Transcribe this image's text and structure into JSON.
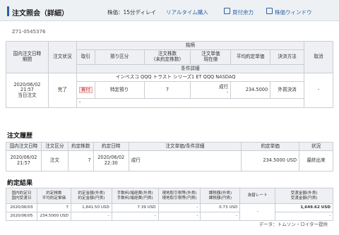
{
  "header": {
    "title": "注文照会（詳細）",
    "delay": "株価：15分ディレイ",
    "realtime_link": "リアルタイム購入",
    "buying_power_link": "買付余力",
    "window_link": "株価ウィンドウ"
  },
  "order_id": "Z71-0545376",
  "main_table": {
    "headers": {
      "order_datetime": "国内注文日時\n期間",
      "status": "注文状況",
      "brand": "銘柄",
      "side": "取引",
      "custody": "預り区分",
      "qty": "注文株数\n(未約定株数)",
      "price": "注文単価\n現在値",
      "avg_price": "平均約定単価",
      "settlement": "決済方法",
      "cancel": "取消",
      "conditions": "条件詳細"
    },
    "row": {
      "datetime": "2020/06/02\n21:57\n当日注文",
      "status": "完了",
      "brand": "インベスコ QQQ トラスト シリーズ1 ET QQQ NASDAQ",
      "side": "買付",
      "custody": "特定預り",
      "qty": "7",
      "order_price": "成行",
      "current_price": "-",
      "avg_price": "234.5000",
      "settlement": "外貨決済",
      "cancel": "-",
      "conditions": "-"
    }
  },
  "history": {
    "title": "注文履歴",
    "headers": [
      "国内注文日時",
      "注文区分",
      "約定株数",
      "約定日時",
      "注文単価/条件詳細",
      "約定単価",
      "状況"
    ],
    "row": {
      "datetime": "2020/06/02\n21:57",
      "type": "注文",
      "qty": "7",
      "exec_datetime": "2020/06/02\n22:30",
      "price": "成行",
      "exec_price": "234.5000 USD",
      "status": "最終出来"
    }
  },
  "execution": {
    "title": "約定結果",
    "headers": {
      "date": "国内約定日\n国内受渡日",
      "qty": "約定株数\n平均約定単価",
      "amount": "約定金額(外貨)\n約定金額(円貨)",
      "fee": "手数料/諸経費(外貨)\n手数料/諸経費(円貨)",
      "local_tax": "現地取引税等(外貨)\n現地取引税等(円貨)",
      "tax": "課税額(外貨)\n課税額(円貨)",
      "rate": "為替レート",
      "settlement": "受渡金額(外貨)\n受渡金額(円貨)"
    },
    "rows": [
      {
        "date": "2020/06/03",
        "qty": "7",
        "amount": "1,641.50 USD",
        "fee": "7.39 USD",
        "local_tax": "-",
        "tax": "0.73 USD",
        "rate": "-",
        "settlement": "1,649.62 USD"
      },
      {
        "date": "2020/06/05",
        "qty": "234.5000 USD",
        "amount": "-",
        "fee": "-",
        "local_tax": "-",
        "tax": "-",
        "rate": "",
        "settlement": "-"
      }
    ]
  },
  "credit": "データ：トムソン・ロイター提供"
}
